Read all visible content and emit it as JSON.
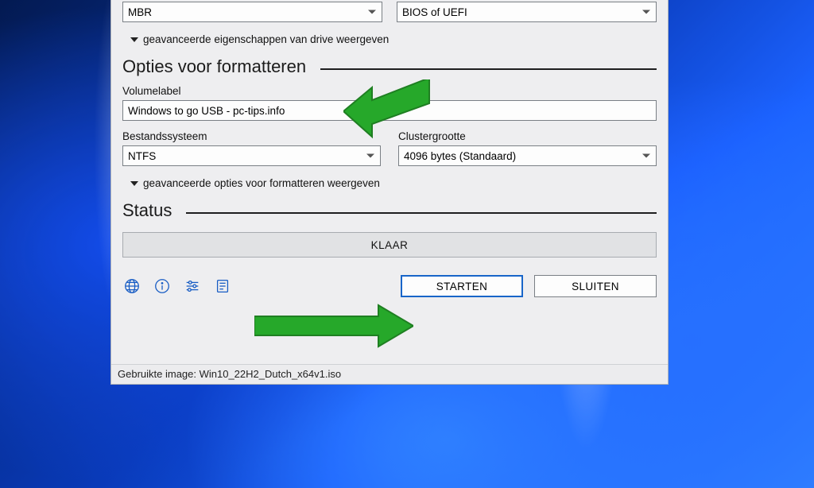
{
  "top_row": {
    "partition_scheme_value": "MBR",
    "target_system_value": "BIOS of UEFI"
  },
  "expanders": {
    "drive": "geavanceerde eigenschappen van drive weergeven",
    "format": "geavanceerde opties voor formatteren weergeven"
  },
  "sections": {
    "format_title": "Opties voor formatteren",
    "status_title": "Status"
  },
  "format": {
    "volume_label_label": "Volumelabel",
    "volume_label_value": "Windows to go USB - pc-tips.info",
    "filesystem_label": "Bestandssysteem",
    "filesystem_value": "NTFS",
    "cluster_label": "Clustergrootte",
    "cluster_value": "4096 bytes (Standaard)"
  },
  "status": {
    "text": "KLAAR"
  },
  "buttons": {
    "start": "STARTEN",
    "close": "SLUITEN"
  },
  "statusbar": {
    "text": "Gebruikte image: Win10_22H2_Dutch_x64v1.iso"
  },
  "icons": {
    "globe": "globe-icon",
    "info": "info-icon",
    "settings": "settings-sliders-icon",
    "log": "log-icon"
  }
}
